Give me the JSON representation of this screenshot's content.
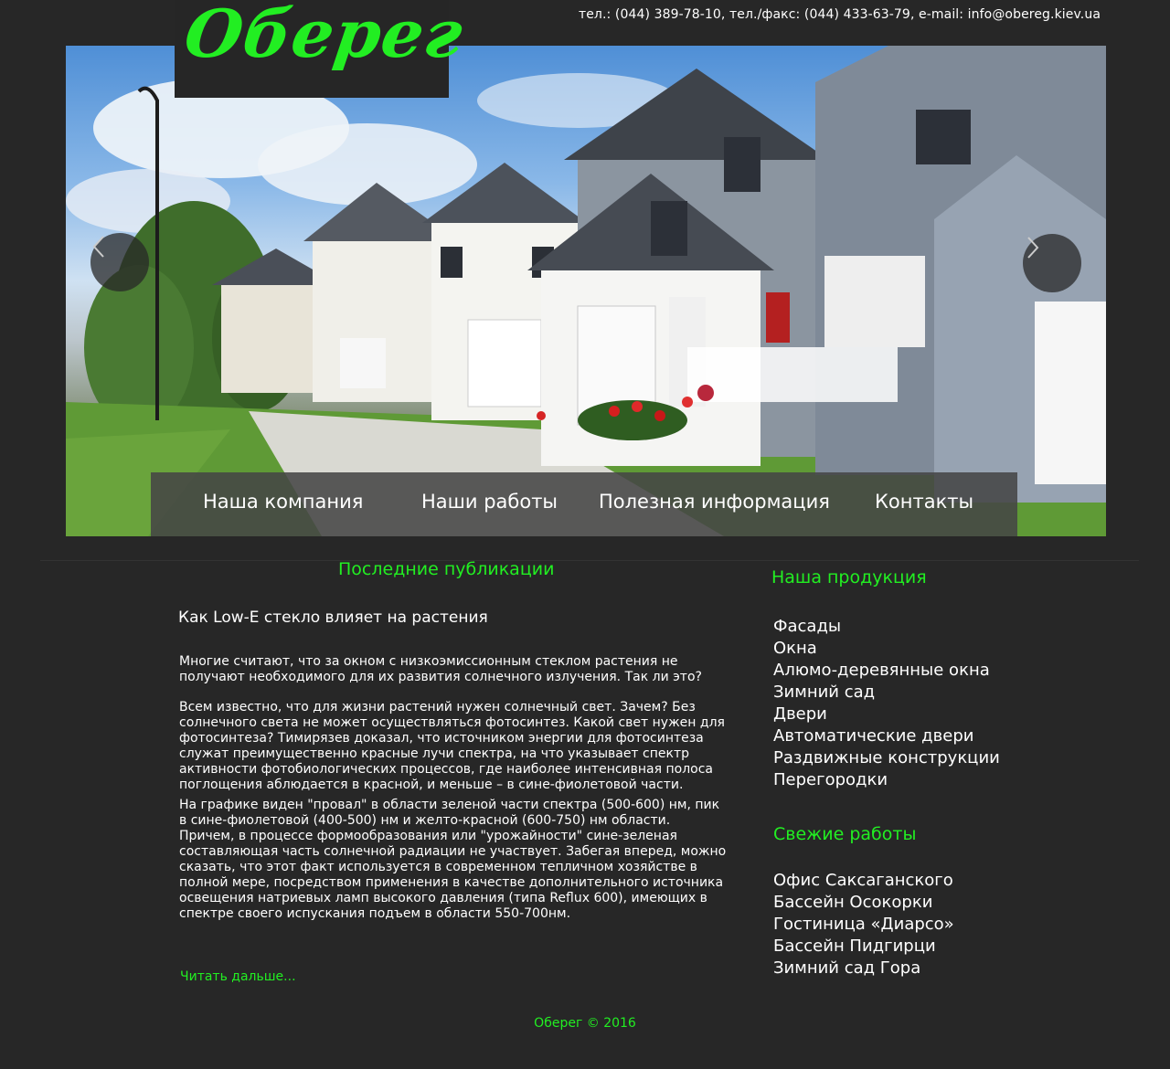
{
  "header": {
    "logo_text": "Оберег",
    "contact_line": "тел.: (044) 389-78-10,  тел./факс: (044) 433-63-79,  e-mail: info@obereg.kiev.ua"
  },
  "slider": {
    "prev_icon": "chevron-left-icon",
    "next_icon": "chevron-right-icon"
  },
  "nav": {
    "items": [
      {
        "label": "Наша компания"
      },
      {
        "label": "Наши работы"
      },
      {
        "label": "Полезная информация"
      },
      {
        "label": "Контакты"
      }
    ]
  },
  "main": {
    "section_title": "Последние публикации",
    "article": {
      "title": "Как Low-E стекло влияет на растения",
      "paragraphs": [
        "Многие считают, что за окном с низкоэмиссионным стеклом растения не получают необходимого для их развития солнечного излучения. Так ли это?",
        "Всем известно, что для жизни растений нужен солнечный свет. Зачем? Без солнечного света не может осуществляться фотосинтез. Какой свет нужен для фотосинтеза? Тимирязев доказал, что источником энергии для фотосинтеза служат преимущественно красные лучи спектра, на что указывает спектр активности фотобиологических процессов, где наиболее интенсивная полоса поглощения аблюдается в красной, и меньше – в сине-фиолетовой части.",
        "На графике виден \"провал\" в области зеленой части спектра (500-600) нм, пик в сине-фиолетовой (400-500) нм и желто-красной (600-750) нм области. Причем, в процессе формообразования или \"урожайности\" сине-зеленая составляющая часть солнечной радиации не участвует. Забегая вперед, можно сказать, что этот факт используется в современном тепличном хозяйстве в полной мере, посредством применения в качестве дополнительного источника освещения натриевых ламп высокого давления (типа Reflux 600), имеющих в спектре своего испускания подъем в области 550-700нм."
      ],
      "read_more": "Читать дальше..."
    }
  },
  "sidebar": {
    "products_title": "Наша продукция",
    "products": [
      "Фасады",
      "Окна",
      "Алюмо-деревянные окна",
      "Зимний сад",
      "Двери",
      "Автоматические двери",
      "Раздвижные конструкции",
      "Перегородки"
    ],
    "works_title": "Свежие работы",
    "works": [
      "Офис Саксаганского",
      "Бассейн Осокорки",
      "Гостиница «Диарсо»",
      "Бассейн Пидгирци",
      "Зимний сад Гора"
    ]
  },
  "footer": {
    "text": "Оберег © 2016"
  },
  "colors": {
    "background": "#272727",
    "accent": "#22ee22",
    "nav_bar": "#464646"
  }
}
